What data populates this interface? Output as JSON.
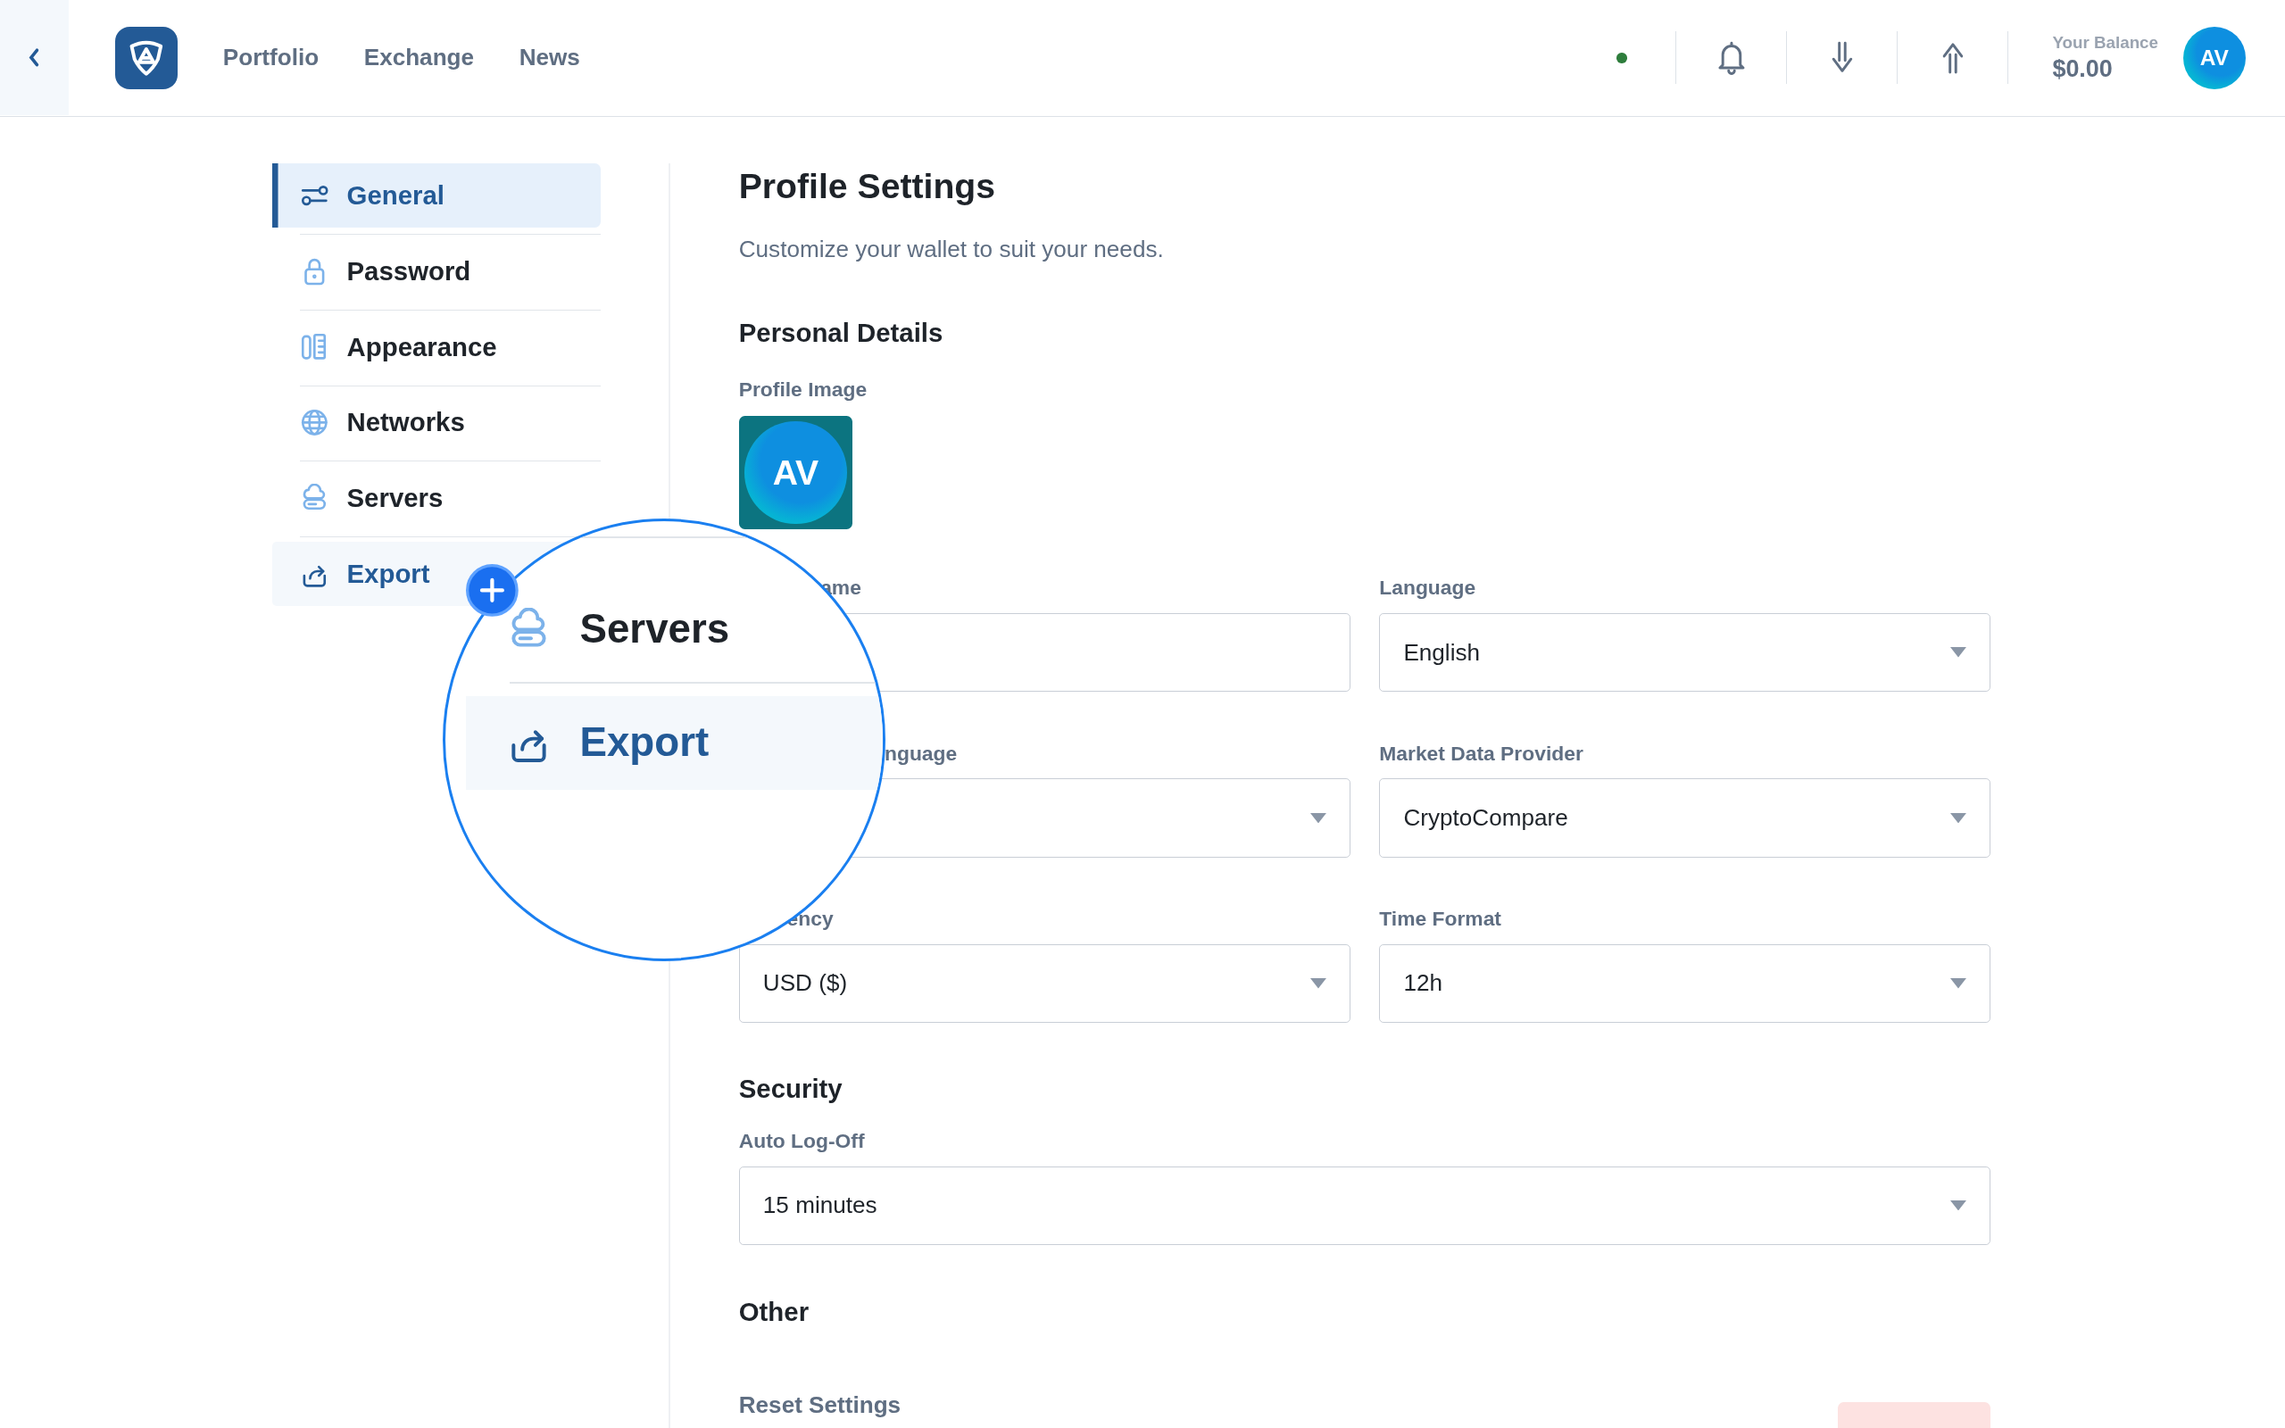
{
  "header": {
    "nav": [
      {
        "label": "Portfolio"
      },
      {
        "label": "Exchange"
      },
      {
        "label": "News"
      }
    ],
    "balance_label": "Your Balance",
    "balance": "$0.00",
    "avatar": "AV"
  },
  "sidebar": {
    "items": [
      {
        "label": "General",
        "selected": true,
        "highlighted": false
      },
      {
        "label": "Password",
        "selected": false,
        "highlighted": false
      },
      {
        "label": "Appearance",
        "selected": false,
        "highlighted": false
      },
      {
        "label": "Networks",
        "selected": false,
        "highlighted": false
      },
      {
        "label": "Servers",
        "selected": false,
        "highlighted": false
      },
      {
        "label": "Export",
        "selected": false,
        "highlighted": true
      }
    ]
  },
  "content": {
    "title": "Profile Settings",
    "subtitle": "Customize your wallet to suit your needs.",
    "personal": {
      "title": "Personal Details",
      "profile_image": {
        "label": "Profile Image",
        "initials": "AV"
      },
      "fields": [
        {
          "label": "ame",
          "kind": "text"
        },
        {
          "label": "Language",
          "kind": "select",
          "value": "English"
        },
        {
          "label": "nguage",
          "kind": "select"
        },
        {
          "label": "Market Data Provider",
          "kind": "select",
          "value": "CryptoCompare"
        },
        {
          "label": "ency",
          "kind": "select",
          "value": "USD ($)"
        },
        {
          "label": "Time Format",
          "kind": "select",
          "value": "12h"
        }
      ]
    },
    "security": {
      "title": "Security",
      "fields": [
        {
          "label": "Auto Log-Off",
          "kind": "select",
          "value": "15 minutes"
        }
      ]
    },
    "other": {
      "title": "Other",
      "items": [
        {
          "label": "Reset Settings"
        }
      ]
    }
  },
  "magnifier": {
    "items": [
      {
        "label": "Servers",
        "highlighted": false
      },
      {
        "label": "Export",
        "highlighted": true
      }
    ]
  }
}
